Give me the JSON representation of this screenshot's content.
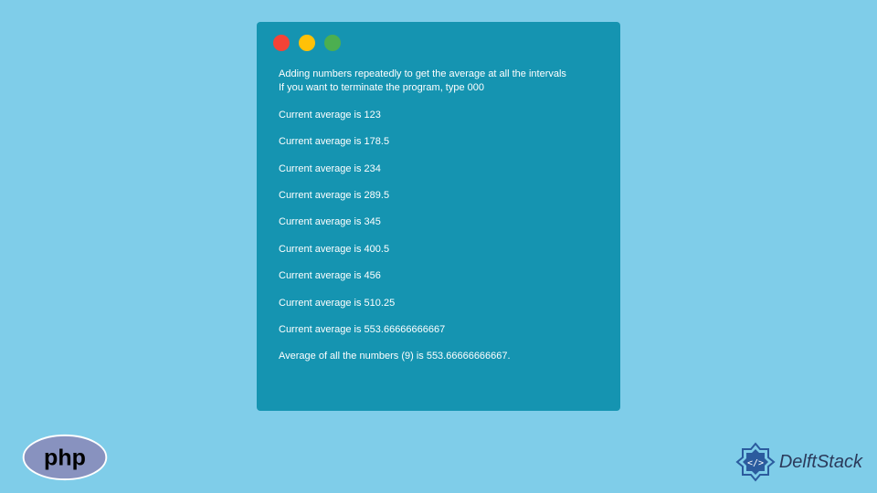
{
  "terminal": {
    "header": {
      "line1": "Adding numbers repeatedly to get the average at all the intervals",
      "line2": "If you want to terminate the program, type 000"
    },
    "averages": [
      "Current average is 123",
      "Current average is 178.5",
      "Current average is 234",
      "Current average is 289.5",
      "Current average is 345",
      "Current average is 400.5",
      "Current average is 456",
      "Current average is 510.25",
      "Current average is 553.66666666667"
    ],
    "final": "Average of all the numbers (9) is 553.66666666667."
  },
  "logos": {
    "php": "php",
    "delft": "DelftStack"
  }
}
